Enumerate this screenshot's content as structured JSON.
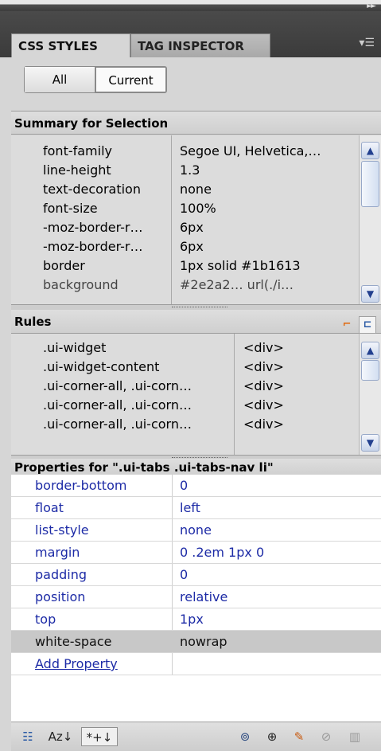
{
  "panel": {
    "tabs": [
      "CSS STYLES",
      "TAG INSPECTOR"
    ],
    "active_tab": "CSS STYLES",
    "panel_menu_icon": "panel-options-icon",
    "collapse_icon": "double-arrow-right-icon"
  },
  "mode_toggle": {
    "all": "All",
    "current": "Current",
    "selected": "Current"
  },
  "summary": {
    "title": "Summary for Selection",
    "rows": [
      {
        "property": "font-family",
        "value": "Segoe UI, Helvetica,…"
      },
      {
        "property": "line-height",
        "value": "1.3"
      },
      {
        "property": "text-decoration",
        "value": "none"
      },
      {
        "property": "font-size",
        "value": "100%"
      },
      {
        "property": "-moz-border-r…",
        "value": "6px"
      },
      {
        "property": "-moz-border-r…",
        "value": "6px"
      },
      {
        "property": "border",
        "value": "1px solid #1b1613"
      },
      {
        "property": "background",
        "value": "#2e2a2… url(./i…"
      }
    ]
  },
  "rules": {
    "title": "Rules",
    "rows": [
      {
        "selector": ".ui-widget",
        "tag": "<div>"
      },
      {
        "selector": ".ui-widget-content",
        "tag": "<div>"
      },
      {
        "selector": ".ui-corner-all, .ui-corn…",
        "tag": "<div>"
      },
      {
        "selector": ".ui-corner-all, .ui-corn…",
        "tag": "<div>"
      },
      {
        "selector": ".ui-corner-all, .ui-corn…",
        "tag": "<div>"
      }
    ]
  },
  "properties": {
    "title": "Properties for \".ui-tabs .ui-tabs-nav li\"",
    "rows": [
      {
        "property": "border-bottom",
        "value": "0"
      },
      {
        "property": "float",
        "value": "left"
      },
      {
        "property": "list-style",
        "value": "none"
      },
      {
        "property": "margin",
        "value": "0 .2em 1px 0"
      },
      {
        "property": "padding",
        "value": "0"
      },
      {
        "property": "position",
        "value": "relative"
      },
      {
        "property": "top",
        "value": "1px"
      },
      {
        "property": "white-space",
        "value": "nowrap"
      }
    ],
    "selected_row": "white-space",
    "add_property": "Add Property"
  },
  "bottom_toolbar": {
    "category_view": "category-view-icon",
    "alpha_view_label": "Az↓",
    "set_props_label": "*+↓",
    "attach_stylesheet": "attach-stylesheet-icon",
    "new_rule": "new-css-rule-icon",
    "edit_rule": "edit-rule-icon",
    "disable": "disable-property-icon",
    "delete": "trash-icon"
  },
  "colors": {
    "link_blue": "#1d2ba6",
    "panel_gray": "#d6d6d6",
    "header_dark": "#3b3b3b"
  }
}
